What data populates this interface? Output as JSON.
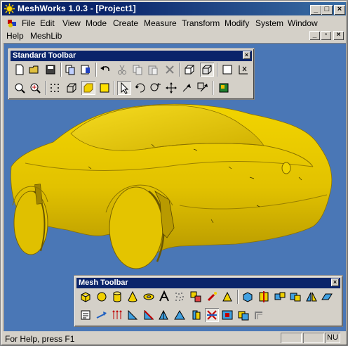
{
  "window": {
    "title": "MeshWorks 1.0.3 - [Project1]"
  },
  "menu": {
    "items": [
      "File",
      "Edit",
      "View",
      "Mode",
      "Create",
      "Measure",
      "Transform",
      "Modify",
      "System",
      "Window"
    ],
    "items_row2": [
      "Help",
      "MeshLib"
    ]
  },
  "standard_toolbar": {
    "title": "Standard Toolbar",
    "row1_icons": [
      "new-document-icon",
      "open-folder-icon",
      "save-icon",
      "copy-view-icon",
      "paste-view-icon",
      "undo-icon",
      "cut-icon",
      "copy-icon",
      "paste-icon",
      "delete-icon",
      "box-icon",
      "box-outline-icon",
      "white-box-icon",
      "corner-select-icon"
    ],
    "row2_icons": [
      "zoom-icon",
      "zoom-fit-icon",
      "point-display-icon",
      "wireframe-icon",
      "shaded-icon",
      "flat-shaded-icon",
      "select-arrow-icon",
      "rotate-icon",
      "zoom-tool-icon",
      "pan-icon",
      "move-icon",
      "axis-icon",
      "render-icon"
    ]
  },
  "mesh_toolbar": {
    "title": "Mesh Toolbar",
    "row1_icons": [
      "cube-icon",
      "sphere-icon",
      "cylinder-icon",
      "cone-icon",
      "torus-icon",
      "text-icon",
      "noise-icon",
      "merge-icon",
      "brush-icon",
      "triangle-icon",
      "face-select-icon",
      "split-icon",
      "box-split-icon",
      "boolean-icon",
      "mirror-icon",
      "plane-icon"
    ],
    "row2_icons": [
      "properties-icon",
      "arrow-tool-icon",
      "up-arrows-icon",
      "triangle-tool-icon",
      "triangle-edge-icon",
      "triangle-split-icon",
      "triangle-fill-icon",
      "extrude-icon",
      "cross-icon",
      "subtract-icon",
      "intersect-icon",
      "corner-icon"
    ]
  },
  "status": {
    "message": "For Help, press F1",
    "num": "NU"
  },
  "colors": {
    "viewport_bg": "#4a77b6",
    "model": "#e6c800",
    "title_bar": "#0a246a"
  }
}
